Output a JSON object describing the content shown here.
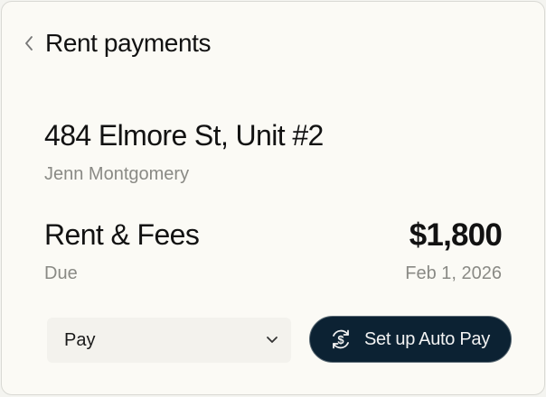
{
  "header": {
    "title": "Rent payments"
  },
  "property": {
    "address": "484 Elmore St, Unit #2",
    "tenant": "Jenn Montgomery"
  },
  "charge": {
    "label": "Rent & Fees",
    "status": "Due",
    "amount": "$1,800",
    "due_date": "Feb 1, 2026"
  },
  "actions": {
    "method_selected": "Pay",
    "autopay_label": "Set up Auto Pay"
  },
  "colors": {
    "primary_button": "#0c2233",
    "background": "#fbfaf5",
    "muted_text": "#8a8a85"
  }
}
